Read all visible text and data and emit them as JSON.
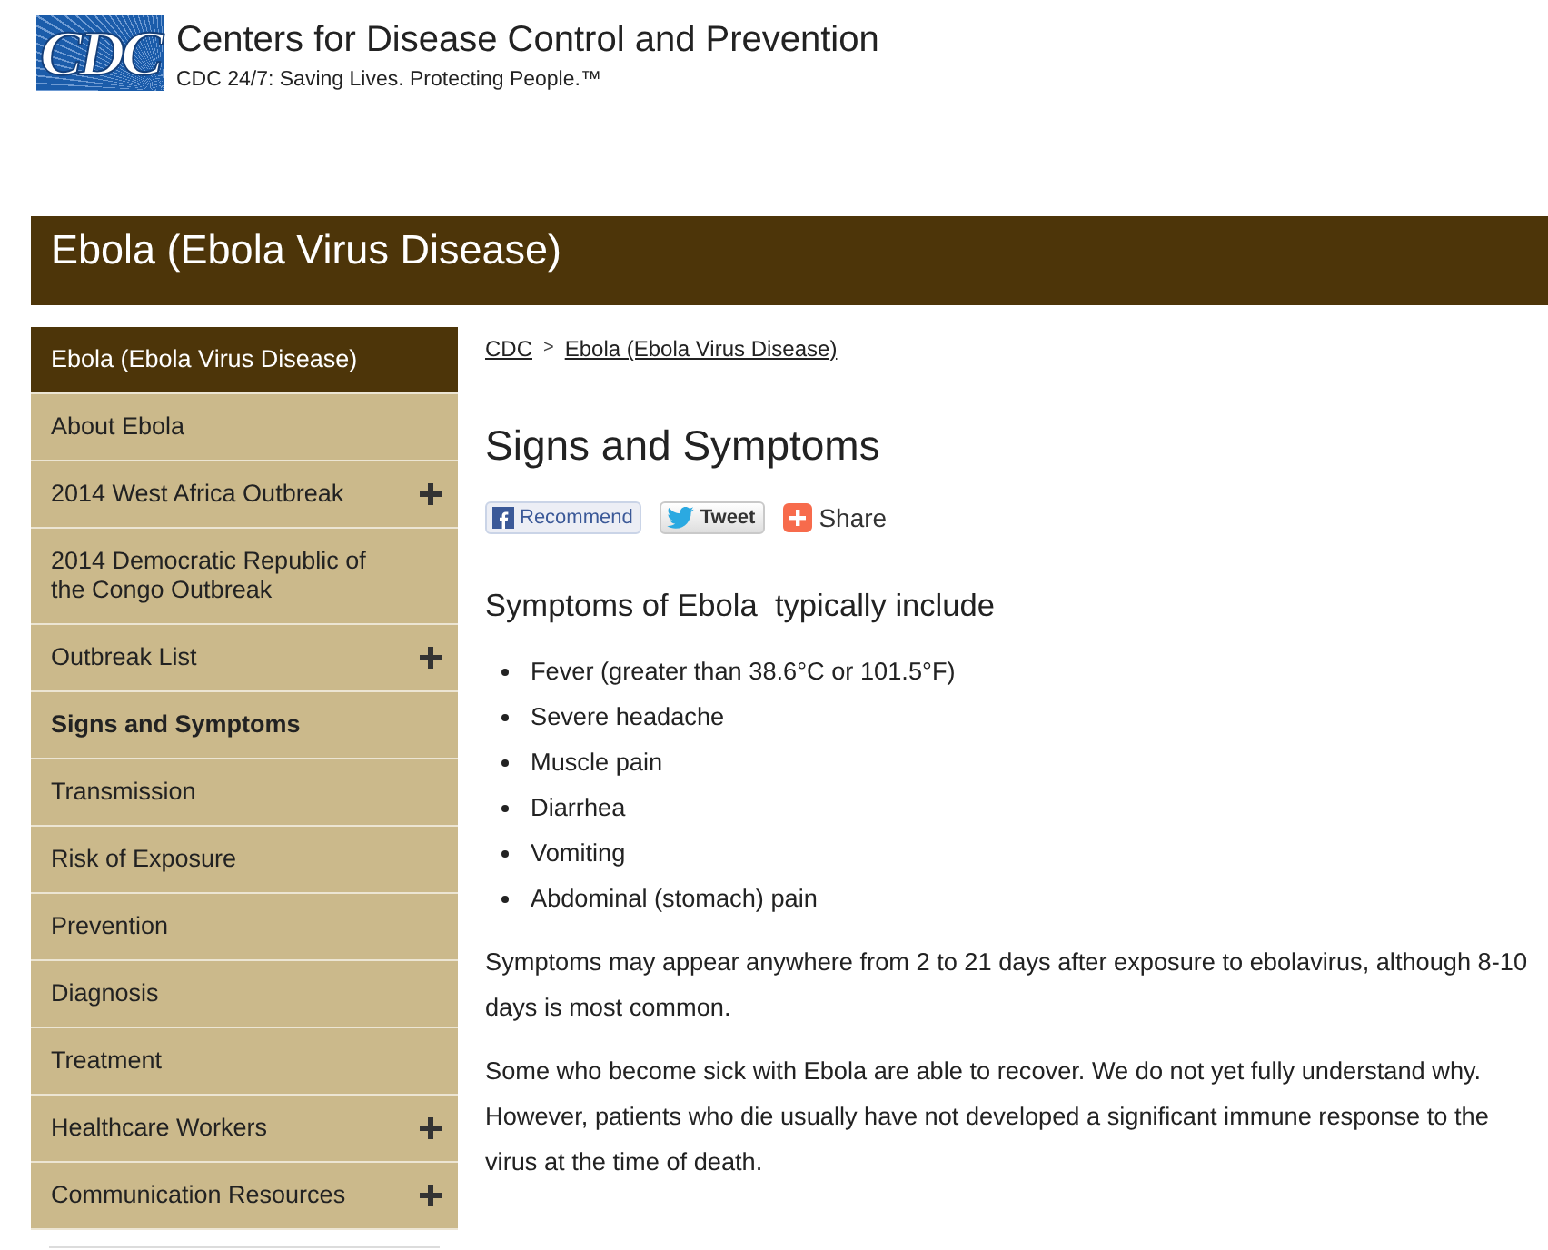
{
  "header": {
    "logo_text": "CDC",
    "title": "Centers for Disease Control and Prevention",
    "tagline": "CDC 24/7: Saving Lives. Protecting People.™"
  },
  "title_bar": {
    "title": "Ebola (Ebola Virus Disease)"
  },
  "sidebar": {
    "heading": "Ebola (Ebola Virus Disease)",
    "items": [
      {
        "label": "About Ebola",
        "selected": false,
        "expandable": false
      },
      {
        "label": "2014 West Africa Outbreak",
        "selected": false,
        "expandable": true
      },
      {
        "label": "2014 Democratic Republic of the Congo Outbreak",
        "selected": false,
        "expandable": false
      },
      {
        "label": "Outbreak List",
        "selected": false,
        "expandable": true
      },
      {
        "label": "Signs and Symptoms",
        "selected": true,
        "expandable": false
      },
      {
        "label": "Transmission",
        "selected": false,
        "expandable": false
      },
      {
        "label": "Risk of Exposure",
        "selected": false,
        "expandable": false
      },
      {
        "label": "Prevention",
        "selected": false,
        "expandable": false
      },
      {
        "label": "Diagnosis",
        "selected": false,
        "expandable": false
      },
      {
        "label": "Treatment",
        "selected": false,
        "expandable": false
      },
      {
        "label": "Healthcare Workers",
        "selected": false,
        "expandable": true
      },
      {
        "label": "Communication Resources",
        "selected": false,
        "expandable": true
      }
    ]
  },
  "breadcrumb": {
    "separator": ">",
    "items": [
      {
        "label": "CDC"
      },
      {
        "label": "Ebola (Ebola Virus Disease)"
      }
    ]
  },
  "heading": "Signs and Symptoms",
  "share_buttons": [
    {
      "kind": "facebook",
      "label": "Recommend"
    },
    {
      "kind": "twitter",
      "label": "Tweet"
    },
    {
      "kind": "share",
      "label": "Share"
    }
  ],
  "subheading": "Symptoms of Ebola  typically include",
  "symptoms": [
    "Fever (greater than 38.6°C or 101.5°F)",
    "Severe headache",
    "Muscle pain",
    "Diarrhea",
    "Vomiting",
    "Abdominal (stomach) pain"
  ],
  "paragraphs": [
    "Symptoms may appear anywhere from 2 to 21 days after exposure to ebolavirus, although 8-10 days is most common.",
    "Some who become sick with Ebola are able to recover. We do not yet fully understand why. However, patients who die usually have not developed a significant immune response to the virus at the time of death."
  ]
}
